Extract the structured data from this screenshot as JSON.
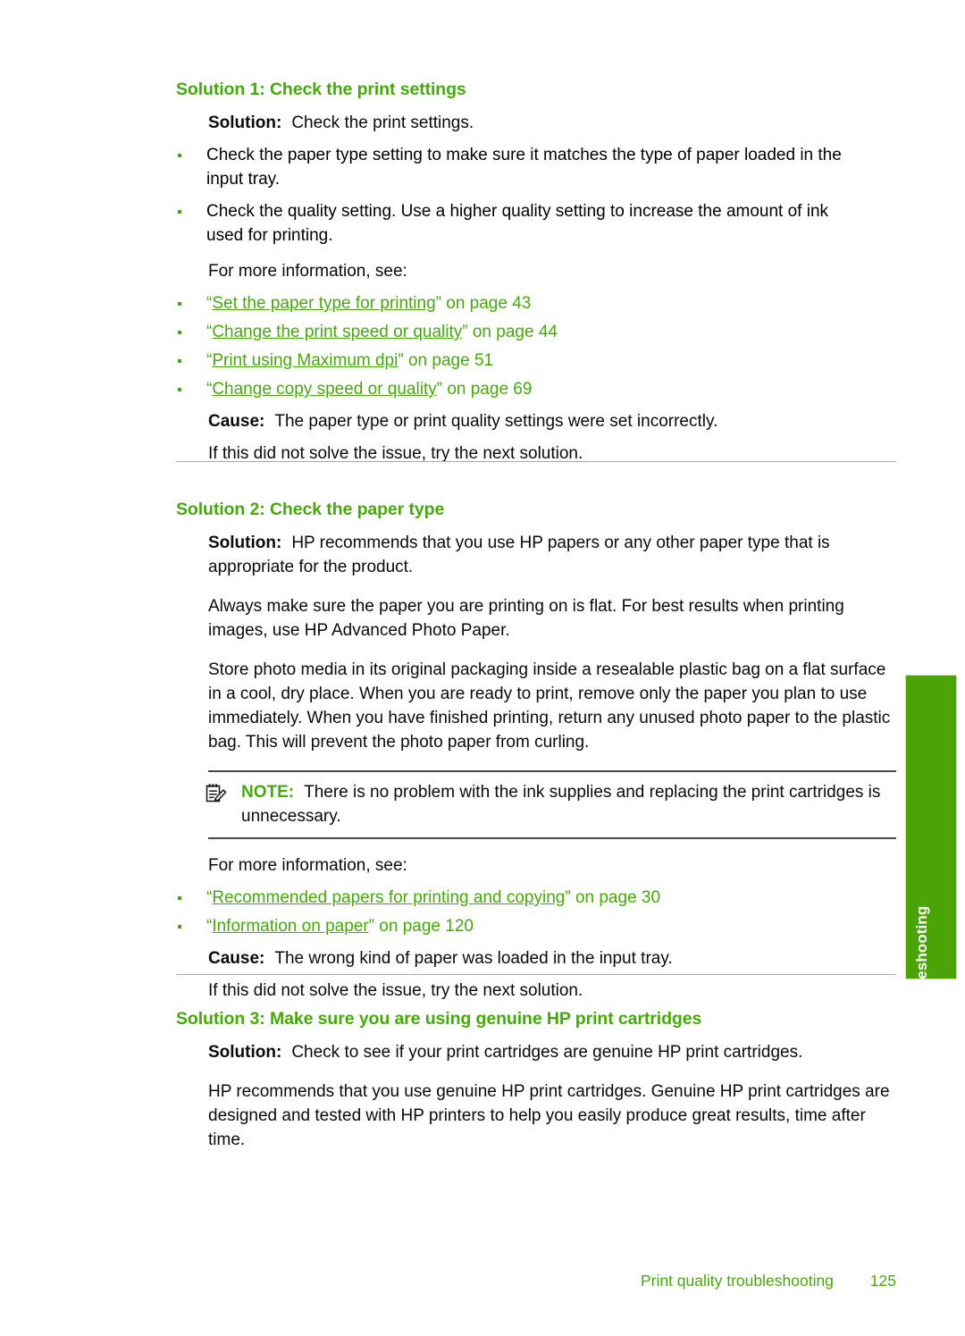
{
  "page": {
    "footer_section": "Print quality troubleshooting",
    "page_number": "125",
    "thumb_tab_label": "Troubleshooting",
    "accent_green": "#47a80d",
    "tab_green": "#4aa406",
    "rule_gray": "#a9a9ad"
  },
  "labels": {
    "solution_label": "Solution:",
    "cause_label": "Cause:",
    "note_label": "NOTE:",
    "for_more_information": "For more information, see:",
    "try_next_solution": "If this did not solve the issue, try the next solution.",
    "on_page": "on page"
  },
  "sections": [
    {
      "heading": "Solution 1: Check the print settings",
      "solution_text": "Check the print settings.",
      "steps": [
        "Check the paper type setting to make sure it matches the type of paper loaded in the input tray.",
        "Check the quality setting. Use a higher quality setting to increase the amount of ink used for printing."
      ],
      "more_info_intro": "For more information, see:",
      "links": [
        {
          "title": "Set the paper type for printing",
          "page": "43"
        },
        {
          "title": "Change the print speed or quality",
          "page": "44"
        },
        {
          "title": "Print using Maximum dpi",
          "page": "51"
        },
        {
          "title": "Change copy speed or quality",
          "page": "69"
        }
      ],
      "cause_text": "The paper type or print quality settings were set incorrectly.",
      "next_text": "If this did not solve the issue, try the next solution."
    },
    {
      "heading": "Solution 2: Check the paper type",
      "solution_text": "HP recommends that you use HP papers or any other paper type that is appropriate for the product.",
      "paragraphs": [
        "Always make sure the paper you are printing on is flat. For best results when printing images, use HP Advanced Photo Paper.",
        "Store photo media in its original packaging inside a resealable plastic bag on a flat surface in a cool, dry place. When you are ready to print, remove only the paper you plan to use immediately. When you have finished printing, return any unused photo paper to the plastic bag. This will prevent the photo paper from curling."
      ],
      "note": {
        "icon": "notepad-pencil-icon",
        "label": "NOTE:",
        "text": "There is no problem with the ink supplies and replacing the print cartridges is unnecessary."
      },
      "more_info_intro": "For more information, see:",
      "links": [
        {
          "title": "Recommended papers for printing and copying",
          "page": "30"
        },
        {
          "title": "Information on paper",
          "page": "120"
        }
      ],
      "cause_text": "The wrong kind of paper was loaded in the input tray.",
      "next_text": "If this did not solve the issue, try the next solution."
    },
    {
      "heading": "Solution 3: Make sure you are using genuine HP print cartridges",
      "solution_text": "Check to see if your print cartridges are genuine HP print cartridges.",
      "paragraphs": [
        "HP recommends that you use genuine HP print cartridges. Genuine HP print cartridges are designed and tested with HP printers to help you easily produce great results, time after time."
      ]
    }
  ]
}
